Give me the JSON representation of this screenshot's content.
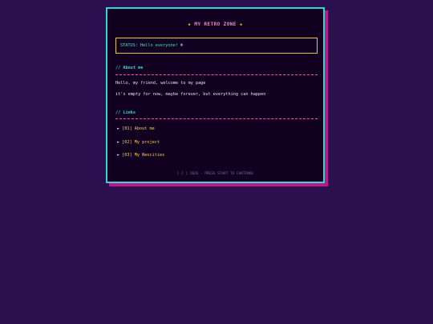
{
  "header": {
    "star_left": "★",
    "title": "MY RETRO ZONE",
    "star_right": "★"
  },
  "status": {
    "text": "STATUS: Hello everyone!",
    "emoticon": "☻"
  },
  "about": {
    "heading": "// About me",
    "lines": [
      "Hello, my friend, welcome to my page",
      "it's empty for now, maybe forever, but everything can happen"
    ]
  },
  "links": {
    "heading": "// Links",
    "arrow": "►",
    "items": [
      {
        "label": "[01] About me"
      },
      {
        "label": "[02] My project"
      },
      {
        "label": "[03] My Neocities"
      }
    ]
  },
  "footer": {
    "text": "[ C ] 2026 - PRESS START TO CONTINUE"
  },
  "colors": {
    "background": "#2b0f4f",
    "card": "#120020",
    "border": "#2fd6d6",
    "shadow": "#c2178a",
    "accent_pink": "#ff77c8",
    "accent_yellow": "#f2d44a"
  }
}
